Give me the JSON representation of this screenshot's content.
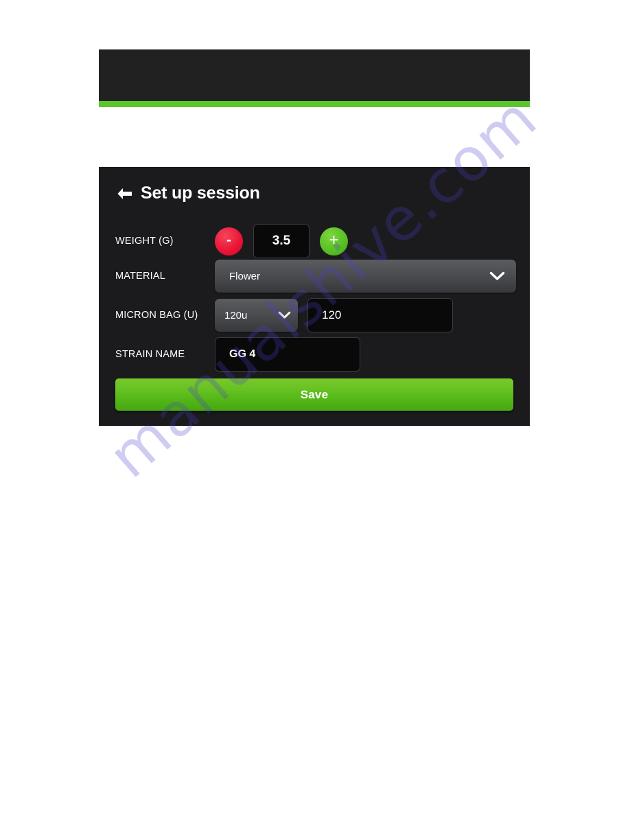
{
  "page": {
    "background_color": "#ffffff",
    "watermark_text": "manualshive.com",
    "watermark_color": "#4b3fcf"
  },
  "banner": {
    "background_color": "#212121",
    "accent_color": "#5cc52c"
  },
  "card": {
    "background_color": "#1b1b1d",
    "back_arrow_label": "back-arrow",
    "title": "Set up session"
  },
  "form": {
    "weight": {
      "label": "WEIGHT (G)",
      "decrement_label": "-",
      "value": "3.5",
      "increment_label": "+",
      "decrement_color": "#ea1133",
      "increment_color": "#56bd22"
    },
    "material": {
      "label": "MATERIAL",
      "value": "Flower"
    },
    "micron_bag": {
      "label": "MICRON BAG (U)",
      "select_value": "120u",
      "input_value": "120"
    },
    "strain": {
      "label": "STRAIN NAME",
      "value": "GG 4"
    }
  },
  "actions": {
    "save_label": "Save",
    "save_color": "#5cc52c"
  }
}
